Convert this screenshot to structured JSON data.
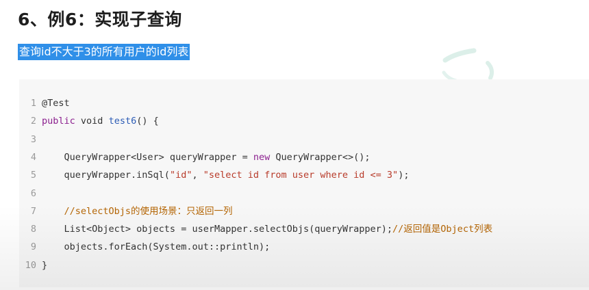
{
  "heading": "6、例6：实现子查询",
  "highlight_text": "查询id不大于3的所有用户的id列表",
  "code": {
    "lines": [
      {
        "num": "1",
        "segs": [
          [
            "@Test",
            ""
          ]
        ]
      },
      {
        "num": "2",
        "segs": [
          [
            "public",
            "kw"
          ],
          [
            " void ",
            ""
          ],
          [
            "test6",
            "fn"
          ],
          [
            "() {",
            ""
          ]
        ]
      },
      {
        "num": "3",
        "segs": []
      },
      {
        "num": "4",
        "segs": [
          [
            "    QueryWrapper<User> queryWrapper = ",
            ""
          ],
          [
            "new",
            "kw"
          ],
          [
            " QueryWrapper<>();",
            ""
          ]
        ]
      },
      {
        "num": "5",
        "segs": [
          [
            "    queryWrapper.inSql(",
            ""
          ],
          [
            "\"id\"",
            "str"
          ],
          [
            ", ",
            ""
          ],
          [
            "\"select id from user where id <= 3\"",
            "str"
          ],
          [
            ");",
            ""
          ]
        ]
      },
      {
        "num": "6",
        "segs": []
      },
      {
        "num": "7",
        "segs": [
          [
            "    //selectObjs的使用场景：只返回一列",
            "cm"
          ]
        ]
      },
      {
        "num": "8",
        "segs": [
          [
            "    List<Object> objects = userMapper.selectObjs(queryWrapper);",
            ""
          ],
          [
            "//返回值是Object列表",
            "cm"
          ]
        ]
      },
      {
        "num": "9",
        "segs": [
          [
            "    objects.forEach(System.out::println);",
            ""
          ]
        ]
      },
      {
        "num": "10",
        "segs": [
          [
            "}",
            ""
          ]
        ]
      }
    ]
  }
}
